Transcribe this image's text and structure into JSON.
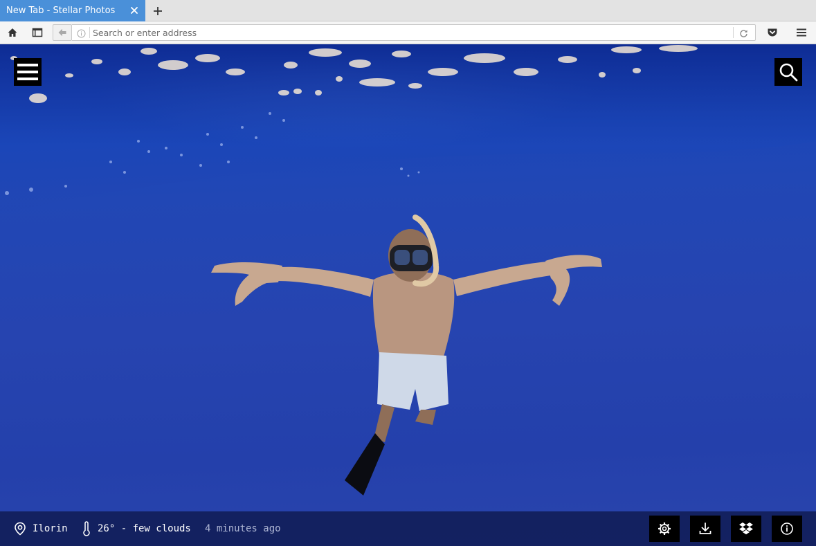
{
  "browser": {
    "tab": {
      "title": "New Tab - Stellar Photos"
    },
    "urlbar": {
      "placeholder": "Search or enter address"
    }
  },
  "page": {
    "location": "Ilorin",
    "weather": "26° - few clouds",
    "updated": "4 minutes ago"
  },
  "icons": {
    "tab_close": "close-icon",
    "new_tab": "plus-icon",
    "home": "home-icon",
    "sidebar": "sidebar-icon",
    "back": "arrow-left-icon",
    "info": "info-circle-icon",
    "reload": "reload-icon",
    "pocket": "pocket-icon",
    "browser_menu": "hamburger-icon",
    "page_menu": "hamburger-icon",
    "page_search": "search-icon",
    "location": "location-pin-icon",
    "temperature": "thermometer-icon",
    "settings": "gear-icon",
    "download": "download-icon",
    "dropbox": "dropbox-icon",
    "about": "info-icon"
  },
  "colors": {
    "tab_active": "#4a90d9",
    "water": "#2244b0",
    "bottom_bar": "#101c54",
    "button_bg": "#000000"
  }
}
